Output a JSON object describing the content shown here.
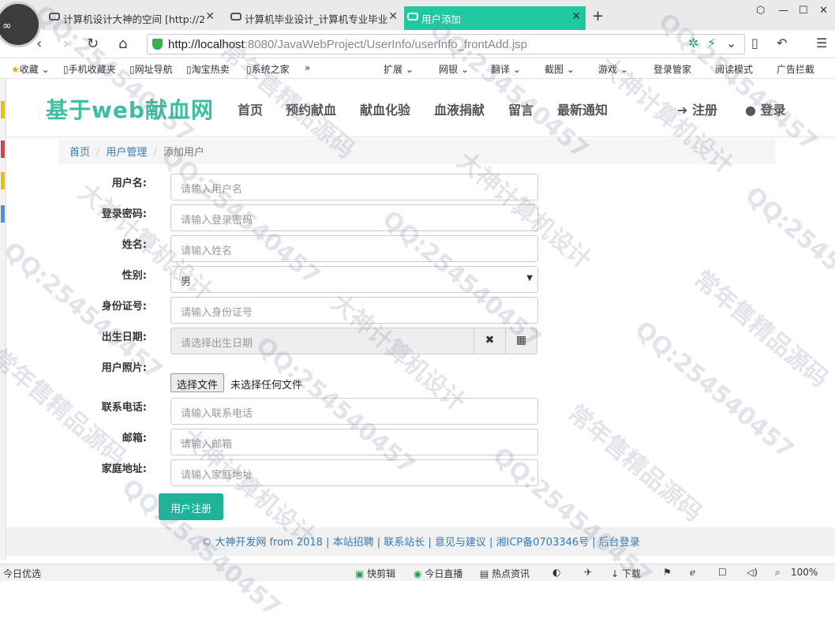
{
  "browser": {
    "tabs": [
      {
        "title": "计算机设计大神的空间 [http://2",
        "active": false
      },
      {
        "title": "计算机毕业设计_计算机专业毕业",
        "active": false
      },
      {
        "title": "用户添加",
        "active": true
      }
    ],
    "new_tab": "+",
    "url_host": "http://localhost",
    "url_rest": ":8080/JavaWebProject/UserInfo/userInfo_frontAdd.jsp",
    "bookmarks": [
      "收藏",
      "手机收藏夹",
      "网址导航",
      "淘宝热卖",
      "系统之家",
      "扩展",
      "网银",
      "翻译",
      "截图",
      "游戏",
      "登录管家",
      "阅读模式",
      "广告拦截"
    ]
  },
  "site": {
    "brand": "基于web献血网",
    "nav": [
      "首页",
      "预约献血",
      "献血化验",
      "血液捐献",
      "留言",
      "最新通知"
    ],
    "register": "注册",
    "login": "登录"
  },
  "breadcrumb": {
    "home": "首页",
    "section": "用户管理",
    "current": "添加用户"
  },
  "form": {
    "username": {
      "label": "用户名:",
      "placeholder": "请输入用户名"
    },
    "password": {
      "label": "登录密码:",
      "placeholder": "请输入登录密码"
    },
    "name": {
      "label": "姓名:",
      "placeholder": "请输入姓名"
    },
    "gender": {
      "label": "性别:",
      "value": "男"
    },
    "idcard": {
      "label": "身份证号:",
      "placeholder": "请输入身份证号"
    },
    "birthday": {
      "label": "出生日期:",
      "placeholder": "请选择出生日期"
    },
    "photo": {
      "label": "用户照片:",
      "button": "选择文件",
      "status": "未选择任何文件"
    },
    "phone": {
      "label": "联系电话:",
      "placeholder": "请输入联系电话"
    },
    "email": {
      "label": "邮箱:",
      "placeholder": "请输入邮箱"
    },
    "address": {
      "label": "家庭地址:",
      "placeholder": "请输入家庭地址"
    },
    "submit": "用户注册"
  },
  "footer": "© 大神开发网 from 2018 | 本站招聘 | 联系站长 | 意见与建议 | 湘ICP备0703346号 | 后台登录",
  "statusbar": {
    "left": "今日优选",
    "items": [
      "快剪辑",
      "今日直播",
      "热点资讯",
      "下载"
    ],
    "zoom": "100%"
  },
  "watermarks": [
    "QQ:254540457",
    "大神计算机设计",
    "常年售精品源码"
  ],
  "colors": {
    "accent": "#1fb49a",
    "brand": "#3cbfa0",
    "tab_active": "#1fc8a0"
  }
}
